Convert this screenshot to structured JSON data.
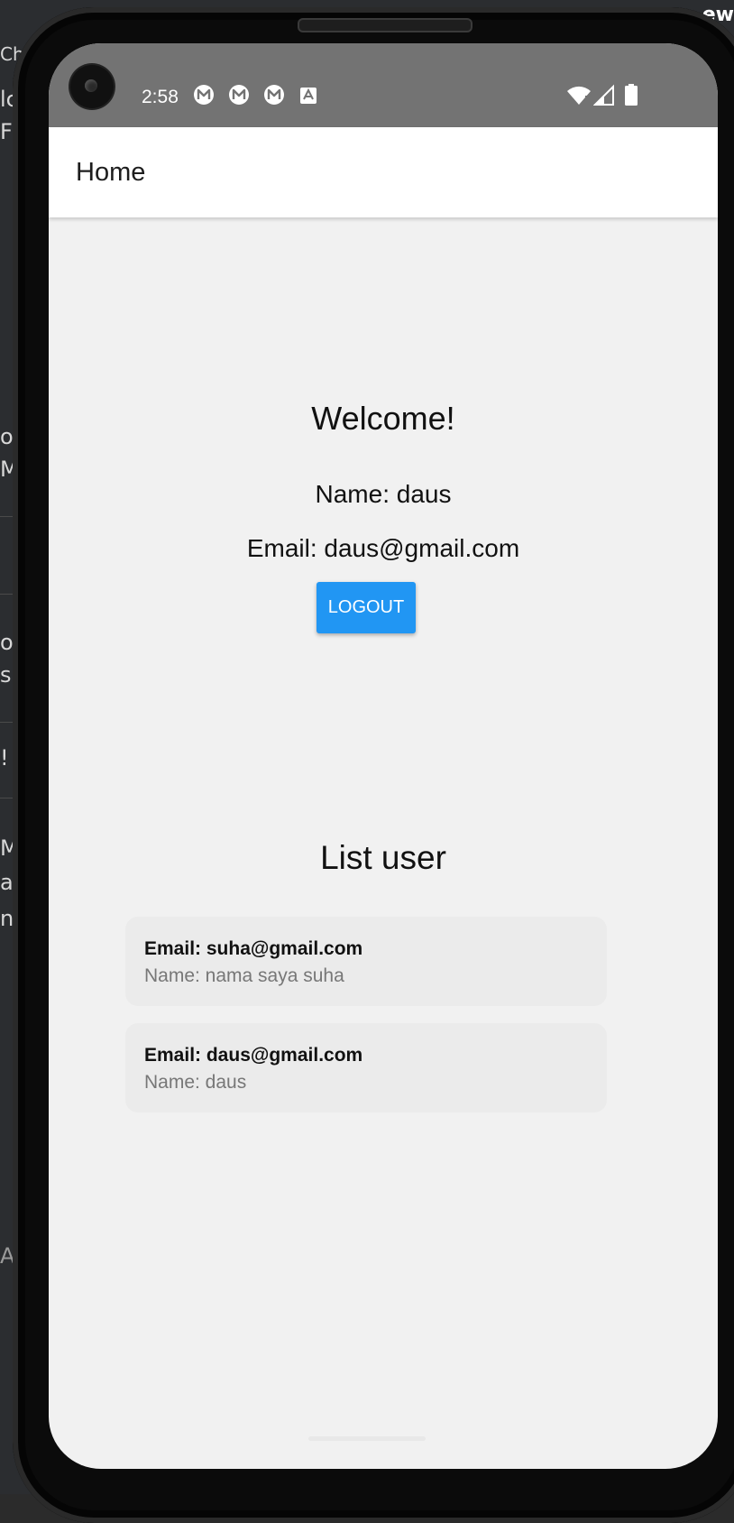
{
  "status_bar": {
    "time": "2:58",
    "icons_left": [
      "mail-m-icon",
      "mail-m-icon",
      "mail-m-icon",
      "text-a-icon"
    ],
    "icons_right": [
      "wifi-icon",
      "signal-icon",
      "battery-icon"
    ]
  },
  "app_bar": {
    "title": "Home"
  },
  "profile": {
    "welcome": "Welcome!",
    "name_line": "Name: daus",
    "email_line": "Email: daus@gmail.com",
    "logout_label": "LOGOUT"
  },
  "list": {
    "title": "List user",
    "users": [
      {
        "email": "Email: suha@gmail.com",
        "name": "Name: nama saya suha"
      },
      {
        "email": "Email: daus@gmail.com",
        "name": "Name: daus"
      }
    ]
  },
  "background": {
    "left_fragments": [
      "Ch",
      "lc",
      "F",
      "o",
      "M",
      "o",
      "s",
      "!",
      "M",
      "a",
      "n",
      "A"
    ],
    "top_right": "ew"
  },
  "colors": {
    "status_bar": "#737373",
    "accent": "#2196f3",
    "screen_bg": "#f1f1f1",
    "card_bg": "#ebebeb"
  }
}
